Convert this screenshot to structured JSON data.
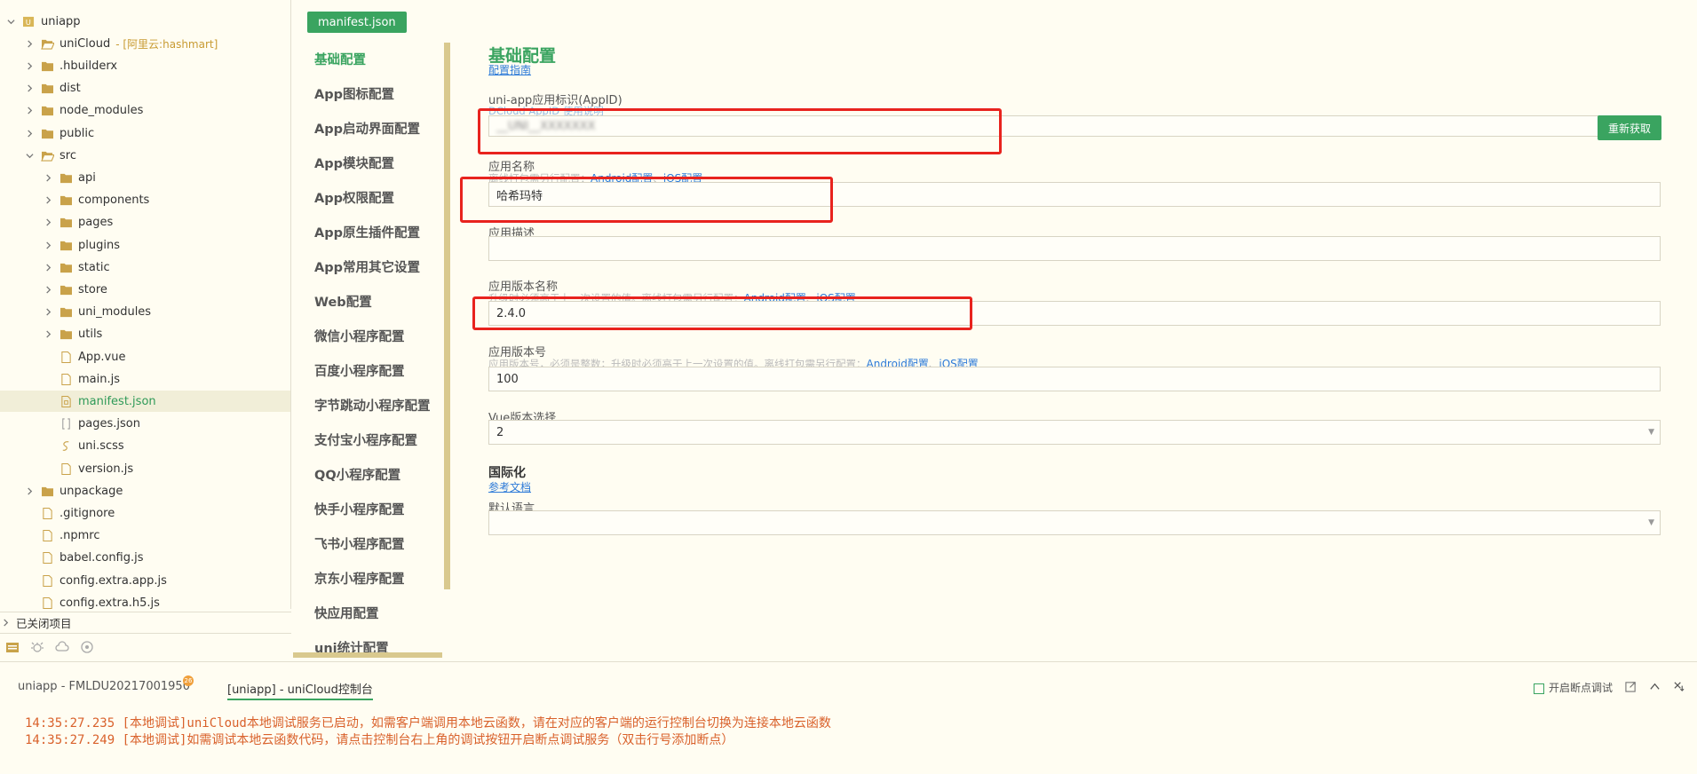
{
  "tree": {
    "items": [
      {
        "label": "uniapp",
        "icon": "project-icon",
        "arrow": "down"
      },
      {
        "label": "uniCloud",
        "suffix": "- [阿里云:hashmart]",
        "icon": "folder-open-icon",
        "arrow": "right"
      },
      {
        "label": ".hbuilderx",
        "icon": "folder-icon",
        "arrow": "right"
      },
      {
        "label": "dist",
        "icon": "folder-icon",
        "arrow": "right"
      },
      {
        "label": "node_modules",
        "icon": "folder-icon",
        "arrow": "right"
      },
      {
        "label": "public",
        "icon": "folder-icon",
        "arrow": "right"
      },
      {
        "label": "src",
        "icon": "folder-open-icon",
        "arrow": "down"
      },
      {
        "label": "api",
        "icon": "folder-icon",
        "arrow": "right"
      },
      {
        "label": "components",
        "icon": "folder-icon",
        "arrow": "right"
      },
      {
        "label": "pages",
        "icon": "folder-icon",
        "arrow": "right"
      },
      {
        "label": "plugins",
        "icon": "folder-icon",
        "arrow": "right"
      },
      {
        "label": "static",
        "icon": "folder-icon",
        "arrow": "right"
      },
      {
        "label": "store",
        "icon": "folder-icon",
        "arrow": "right"
      },
      {
        "label": "uni_modules",
        "icon": "folder-icon",
        "arrow": "right"
      },
      {
        "label": "utils",
        "icon": "folder-icon",
        "arrow": "right"
      },
      {
        "label": "App.vue",
        "icon": "file-icon",
        "arrow": ""
      },
      {
        "label": "main.js",
        "icon": "file-icon",
        "arrow": ""
      },
      {
        "label": "manifest.json",
        "icon": "json-file-icon",
        "arrow": "",
        "selected": true
      },
      {
        "label": "pages.json",
        "icon": "json-bracket-icon",
        "arrow": ""
      },
      {
        "label": "uni.scss",
        "icon": "scss-file-icon",
        "arrow": ""
      },
      {
        "label": "version.js",
        "icon": "file-icon",
        "arrow": ""
      },
      {
        "label": "unpackage",
        "icon": "folder-icon",
        "arrow": "right"
      },
      {
        "label": ".gitignore",
        "icon": "file-icon",
        "arrow": ""
      },
      {
        "label": ".npmrc",
        "icon": "file-icon",
        "arrow": ""
      },
      {
        "label": "babel.config.js",
        "icon": "file-icon",
        "arrow": ""
      },
      {
        "label": "config.extra.app.js",
        "icon": "file-icon",
        "arrow": ""
      },
      {
        "label": "config.extra.h5.js",
        "icon": "file-icon",
        "arrow": ""
      }
    ],
    "closed_projects": "已关闭项目"
  },
  "tab": {
    "label": "manifest.json"
  },
  "nav": {
    "items": [
      "基础配置",
      "App图标配置",
      "App启动界面配置",
      "App模块配置",
      "App权限配置",
      "App原生插件配置",
      "App常用其它设置",
      "Web配置",
      "微信小程序配置",
      "百度小程序配置",
      "字节跳动小程序配置",
      "支付宝小程序配置",
      "QQ小程序配置",
      "快手小程序配置",
      "飞书小程序配置",
      "京东小程序配置",
      "快应用配置",
      "uni统计配置"
    ]
  },
  "form": {
    "title": "基础配置",
    "guide_link": "配置指南",
    "appid": {
      "label": "uni-app应用标识(AppID)",
      "hint": "DCloud AppID 使用说明",
      "value": "__UNI__XXXXXXX",
      "button": "重新获取"
    },
    "name": {
      "label": "应用名称",
      "hint": "离线打包需另行配置：",
      "link1": "Android配置",
      "sep": "、",
      "link2": "iOS配置",
      "value": "哈希玛特"
    },
    "desc": {
      "label": "应用描述",
      "value": ""
    },
    "version_name": {
      "label": "应用版本名称",
      "hint": "升级时必须高于上一次设置的值。离线打包需另行配置：",
      "link1": "Android配置",
      "sep": "、",
      "link2": "iOS配置",
      "value": "2.4.0"
    },
    "version_code": {
      "label": "应用版本号",
      "hint": "应用版本号，必须是整数；升级时必须高于上一次设置的值。离线打包需另行配置：",
      "link1": "Android配置",
      "sep": "、",
      "link2": "iOS配置",
      "value": "100"
    },
    "vue": {
      "label": "Vue版本选择",
      "value": "2"
    },
    "i18n": {
      "title": "国际化",
      "doc_link": "参考文档",
      "default_lang_label": "默认语言",
      "default_lang_value": ""
    }
  },
  "console": {
    "tab1": "uniapp - FMLDU20217001950",
    "badge": "26",
    "tab2": "[uniapp] - uniCloud控制台",
    "breakpoint_label": "开启断点调试",
    "logs": [
      "14:35:27.235 [本地调试]uniCloud本地调试服务已启动，如需客户端调用本地云函数，请在对应的客户端的运行控制台切换为连接本地云函数",
      "14:35:27.249 [本地调试]如需调试本地云函数代码，请点击控制台右上角的调试按钮开启断点调试服务（双击行号添加断点）"
    ]
  },
  "colors": {
    "accent": "#3aa460",
    "link": "#2e7bd8",
    "highlight": "#e8231e",
    "log": "#d9612b"
  }
}
